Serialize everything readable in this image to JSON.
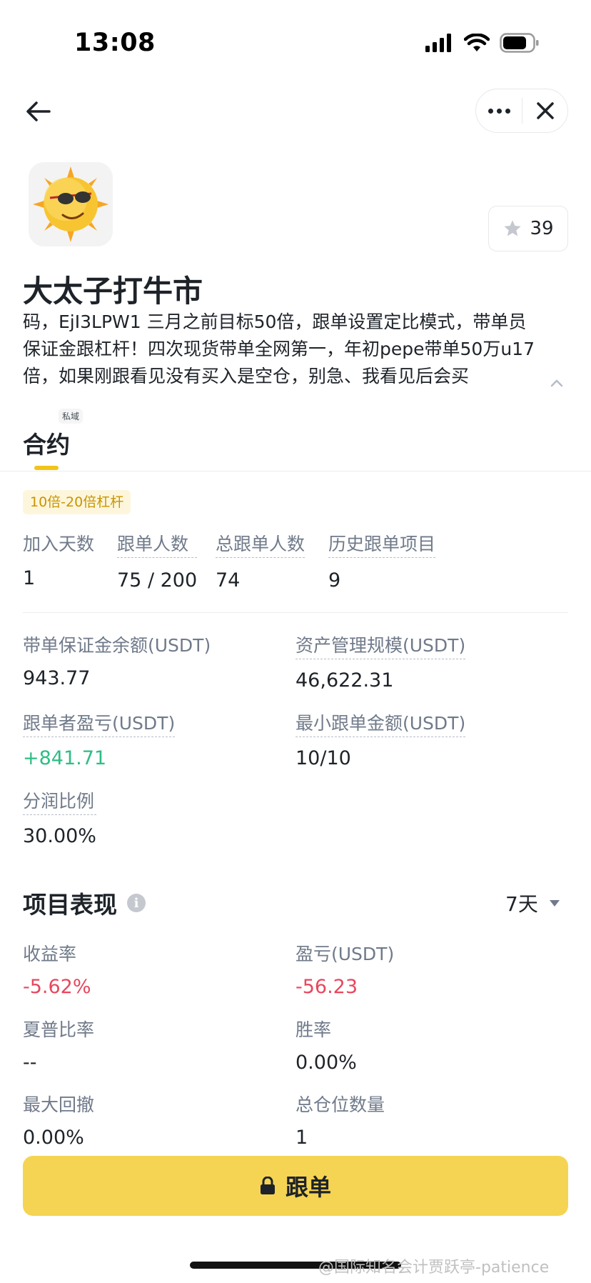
{
  "status_bar": {
    "time": "13:08"
  },
  "nav": {
    "back_icon": "arrow-left-icon",
    "more_icon": "more-horizontal-icon",
    "close_icon": "close-icon"
  },
  "profile": {
    "name": "大太子打牛市",
    "favorite_count": "39",
    "bio": "码，EjI3LPW1 三月之前目标50倍，跟单设置定比模式，带单员保证金跟杠杆！四次现货带单全网第一，年初pepe带单50万u17倍，如果刚跟看见没有买入是空仓，别急、我看见后会买"
  },
  "tabs": {
    "private_badge": "私域",
    "active": "合约"
  },
  "leverage_badge": "10倍-20倍杠杆",
  "basic_stats": [
    {
      "label": "加入天数",
      "value": "1"
    },
    {
      "label": "跟单人数",
      "value": "75 / 200"
    },
    {
      "label": "总跟单人数",
      "value": "74"
    },
    {
      "label": "历史跟单项目",
      "value": "9"
    }
  ],
  "account": {
    "margin_balance": {
      "label": "带单保证金余额(USDT)",
      "value": "943.77"
    },
    "aum": {
      "label": "资产管理规模(USDT)",
      "value": "46,622.31"
    },
    "follower_pnl": {
      "label": "跟单者盈亏(USDT)",
      "value": "+841.71"
    },
    "min_amount": {
      "label": "最小跟单金额(USDT)",
      "value": "10/10"
    },
    "profit_share": {
      "label": "分润比例",
      "value": "30.00%"
    }
  },
  "performance": {
    "title": "项目表现",
    "period": "7天",
    "roi": {
      "label": "收益率",
      "value": "-5.62%"
    },
    "pnl": {
      "label": "盈亏(USDT)",
      "value": "-56.23"
    },
    "sharpe": {
      "label": "夏普比率",
      "value": "--"
    },
    "win_rate": {
      "label": "胜率",
      "value": "0.00%"
    },
    "max_drawdown": {
      "label": "最大回撤",
      "value": "0.00%"
    },
    "total_positions": {
      "label": "总仓位数量",
      "value": "1"
    }
  },
  "follow_button": {
    "label": "跟单"
  },
  "watermark": "@国际知名会计贾跃亭-patience",
  "colors": {
    "accent": "#f5d453",
    "profit": "#2ebd85",
    "loss": "#e8475d"
  }
}
